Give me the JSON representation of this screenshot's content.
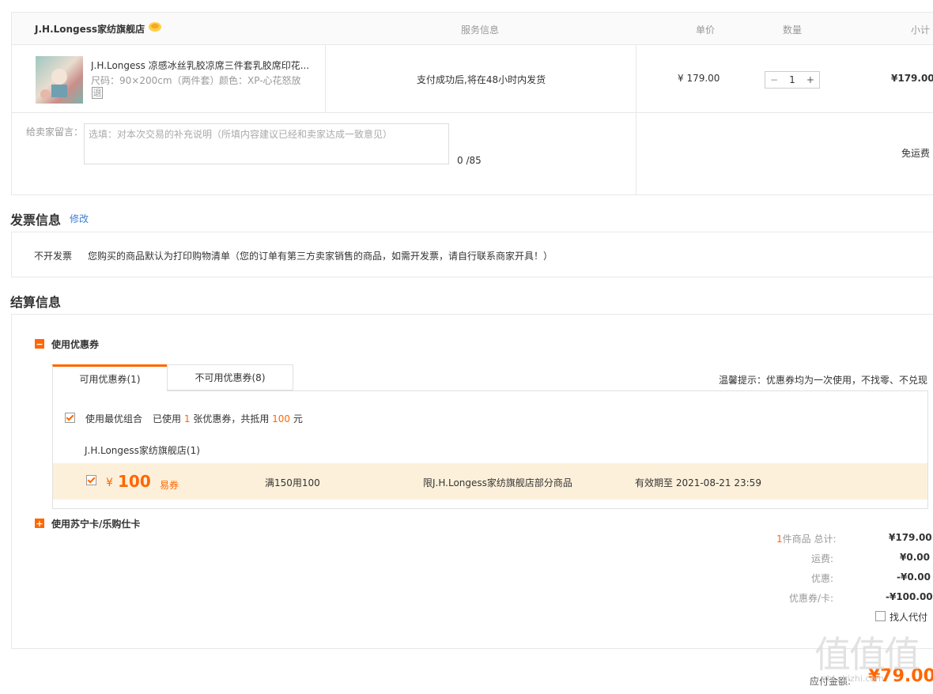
{
  "header": {
    "shop_name": "J.H.Longess家纺旗舰店",
    "col_service": "服务信息",
    "col_price": "单价",
    "col_qty": "数量",
    "col_subtotal": "小计"
  },
  "product": {
    "title": "J.H.Longess 凉感冰丝乳胶凉席三件套乳胶席印花...",
    "size": "尺码：90×200cm（两件套）",
    "color": "颜色：XP-心花怒放",
    "return_badge": "退",
    "service": "支付成功后,将在48小时内发货",
    "price": "¥ 179.00",
    "qty": "1",
    "minus": "−",
    "plus": "+",
    "subtotal": "¥179.00"
  },
  "message": {
    "label": "给卖家留言：",
    "placeholder": "选填：对本次交易的补充说明（所填内容建议已经和卖家达成一致意见）",
    "counter": "0 /85",
    "shipping": "免运费"
  },
  "invoice": {
    "title": "发票信息",
    "edit_link": "修改",
    "type": "不开发票",
    "note": "您购买的商品默认为打印购物清单（您的订单有第三方卖家销售的商品，如需开发票，请自行联系商家开具！）"
  },
  "settlement": {
    "title": "结算信息",
    "coupon_section": "使用优惠券",
    "tab_available": "可用优惠券(1)",
    "tab_unavailable": "不可用优惠券(8)",
    "tip": "温馨提示：优惠券均为一次使用，不找零、不兑现",
    "best_combo_label": "使用最优组合",
    "used_prefix": "已使用",
    "used_count": "1",
    "used_mid": "张优惠券，共抵用",
    "used_amount": "100",
    "used_suffix": "元",
    "shop_group": "J.H.Longess家纺旗舰店(1)",
    "coupon": {
      "currency": "¥",
      "amount": "100",
      "tag": "易券",
      "condition": "满150用100",
      "scope": "限J.H.Longess家纺旗舰店部分商品",
      "validity": "有效期至 2021-08-21 23:59"
    },
    "card_section": "使用苏宁卡/乐购仕卡"
  },
  "summary": {
    "count": "1",
    "count_label": "件商品 总计:",
    "total": "¥179.00",
    "shipping_label": "运费:",
    "shipping": "¥0.00",
    "discount_label": "优惠:",
    "discount": "-¥0.00",
    "coupon_label": "优惠券/卡:",
    "coupon": "-¥100.00",
    "proxy_pay": "找人代付",
    "payable_label": "应付金额:",
    "payable": "¥79.00"
  },
  "watermark": {
    "glyphs": "值值值",
    "url": "zhi.zhizhi.com"
  },
  "colors": {
    "accent": "#ff6600",
    "coupon_bg": "#fdf0da",
    "link": "#3d7fd1"
  }
}
